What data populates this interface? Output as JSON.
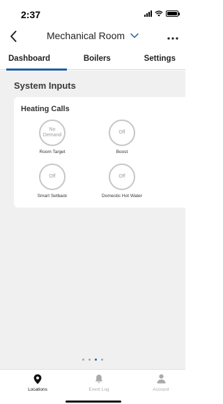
{
  "status_bar": {
    "time": "2:37"
  },
  "header": {
    "title": "Mechanical Room"
  },
  "tabs": [
    {
      "label": "Dashboard"
    },
    {
      "label": "Boilers"
    },
    {
      "label": "Settings"
    }
  ],
  "system_inputs": {
    "title": "System Inputs",
    "card_title": "Heating Calls",
    "calls": [
      {
        "state_line1": "No",
        "state_line2": "Demand",
        "label": "Room Target"
      },
      {
        "state_line1": "Off",
        "state_line2": "",
        "label": "Boost"
      },
      {
        "state_line1": "Off",
        "state_line2": "",
        "label": "Smart Setback"
      },
      {
        "state_line1": "Off",
        "state_line2": "",
        "label": "Domestic Hot Water"
      }
    ]
  },
  "pager": {
    "count": 4,
    "active_index": 2
  },
  "bottom_nav": [
    {
      "label": "Locations",
      "icon": "location-pin-icon",
      "active": true
    },
    {
      "label": "Event Log",
      "icon": "bell-icon",
      "active": false
    },
    {
      "label": "Account",
      "icon": "person-icon",
      "active": false
    }
  ],
  "colors": {
    "accent": "#1e5fa8",
    "content_bg": "#f0f0f0",
    "circle_border": "#c6c6c6",
    "inactive_text": "#aaaaaa"
  }
}
